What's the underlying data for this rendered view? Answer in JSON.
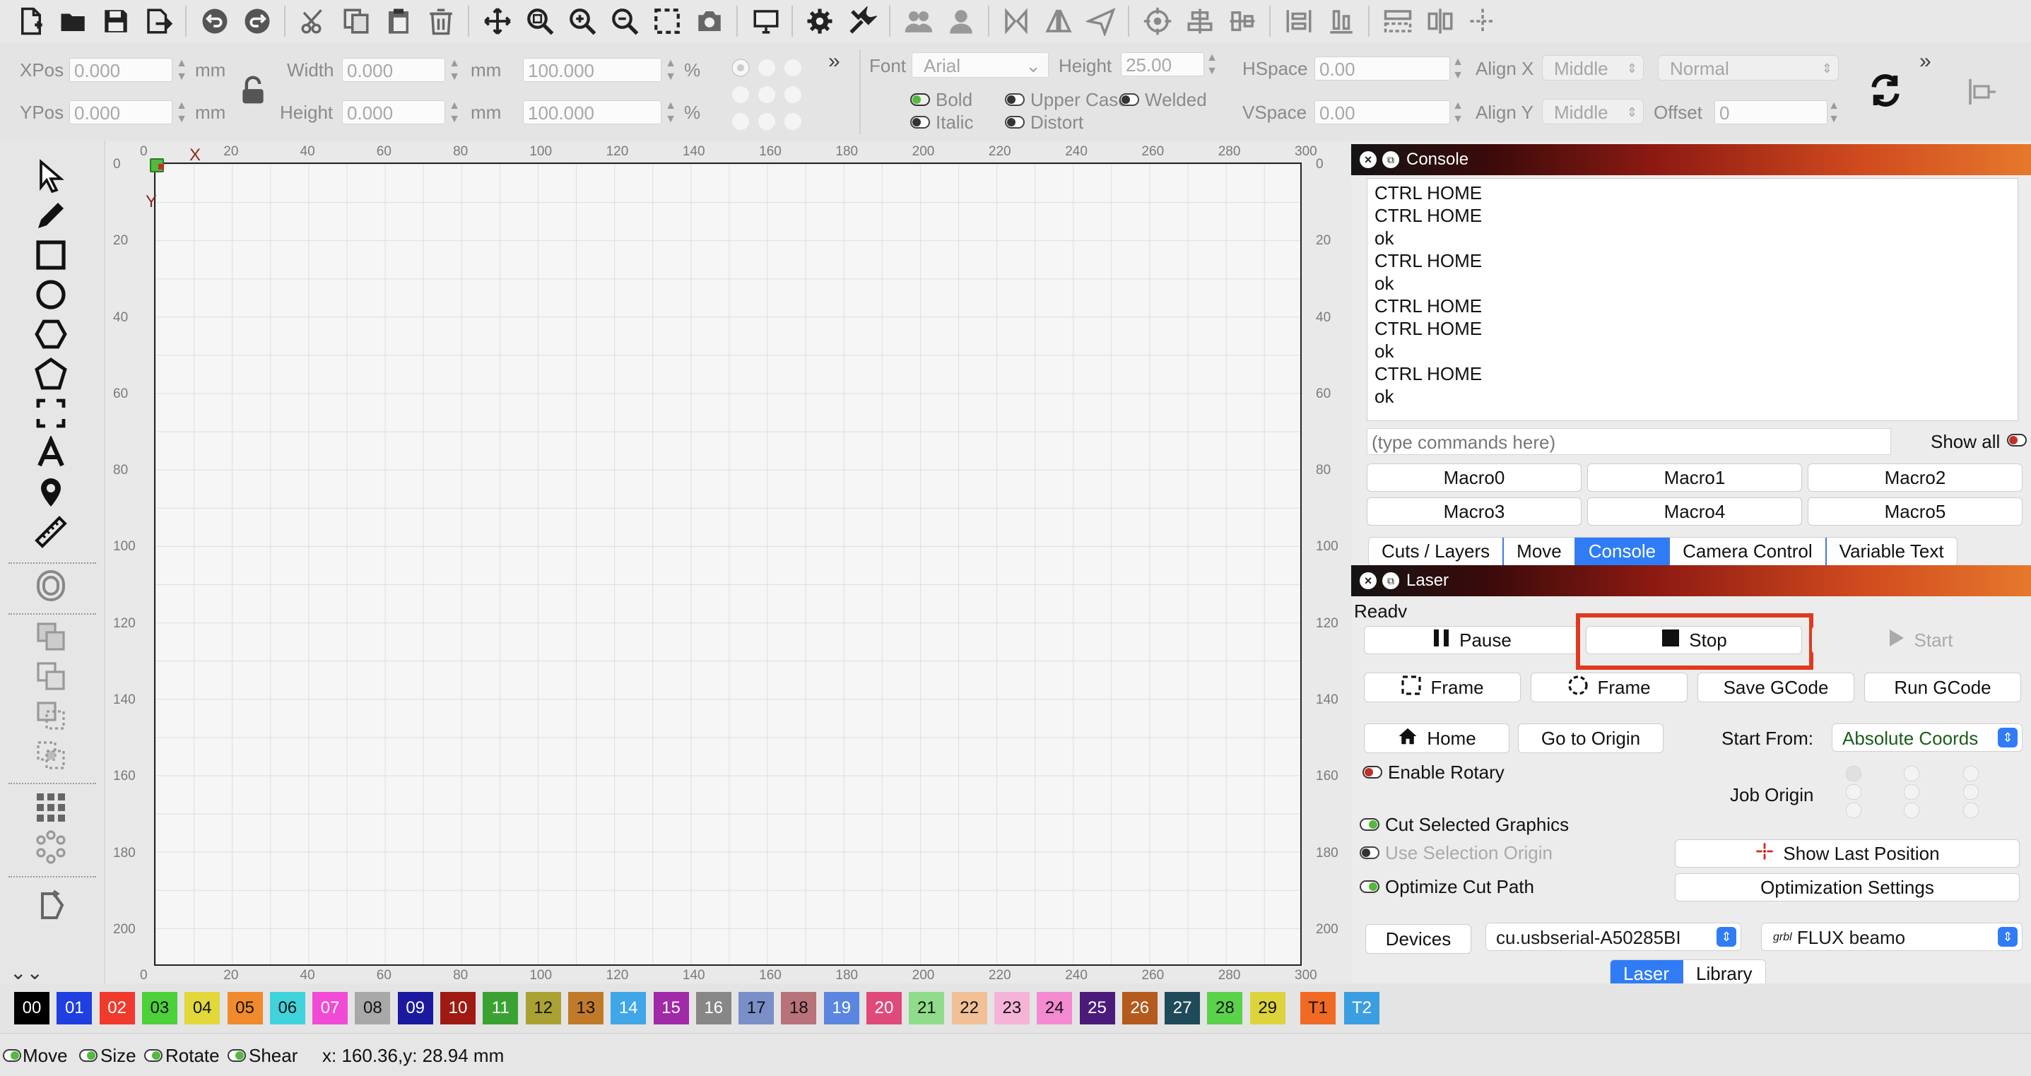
{
  "toolbar": {
    "icons": [
      "new-file-icon",
      "open-folder-icon",
      "save-icon",
      "export-icon",
      "undo-icon",
      "redo-icon",
      "cut-icon",
      "copy-icon",
      "paste-icon",
      "delete-icon",
      "move-icon",
      "zoom-fit-icon",
      "zoom-in-icon",
      "zoom-out-icon",
      "select-frame-icon",
      "camera-icon",
      "monitor-icon",
      "settings-icon",
      "tools-icon",
      "users-icon",
      "user-icon",
      "mirror-h-icon",
      "mirror-v-icon",
      "send-icon",
      "target-icon",
      "align-center-icon",
      "align-middle-icon",
      "distribute-h-icon",
      "distribute-v-icon",
      "dock-icon",
      "align-edge-icon",
      "crosshair-icon"
    ]
  },
  "properties": {
    "xpos_label": "XPos",
    "xpos_value": "0.000",
    "ypos_label": "YPos",
    "ypos_value": "0.000",
    "unit_mm": "mm",
    "width_label": "Width",
    "width_value": "0.000",
    "height_label": "Height",
    "height_value": "0.000",
    "scale_w": "100.000",
    "scale_h": "100.000",
    "percent": "%",
    "more": "»",
    "font_label": "Font",
    "font_value": "Arial",
    "text_height_label": "Height",
    "text_height_value": "25.00",
    "bold": "Bold",
    "italic": "Italic",
    "upper_case": "Upper Case",
    "welded": "Welded",
    "distort": "Distort",
    "hspace_label": "HSpace",
    "hspace_value": "0.00",
    "vspace_label": "VSpace",
    "vspace_value": "0.00",
    "alignx_label": "Align X",
    "alignx_value": "Middle",
    "aligny_label": "Align Y",
    "aligny_value": "Middle",
    "normal_value": "Normal",
    "offset_label": "Offset",
    "offset_value": "0"
  },
  "rulers": {
    "top": [
      "0",
      "20",
      "40",
      "60",
      "80",
      "100",
      "120",
      "140",
      "160",
      "180",
      "200",
      "220",
      "240",
      "260",
      "280",
      "300"
    ],
    "left": [
      "0",
      "20",
      "40",
      "60",
      "80",
      "100",
      "120",
      "140",
      "160",
      "180",
      "200"
    ],
    "axis_x": "X",
    "axis_y": "Y"
  },
  "console": {
    "title": "Console",
    "lines": [
      "CTRL HOME",
      "CTRL HOME",
      "ok",
      "CTRL HOME",
      "ok",
      "CTRL HOME",
      "CTRL HOME",
      "ok",
      "CTRL HOME",
      "ok"
    ],
    "command_placeholder": "(type commands here)",
    "show_all": "Show all",
    "macros": [
      "Macro0",
      "Macro1",
      "Macro2",
      "Macro3",
      "Macro4",
      "Macro5"
    ],
    "tabs": [
      "Cuts / Layers",
      "Move",
      "Console",
      "Camera Control",
      "Variable Text"
    ],
    "active_tab": "Console"
  },
  "laser": {
    "title": "Laser",
    "status": "Readv",
    "pause": "Pause",
    "stop": "Stop",
    "start": "Start",
    "frame1": "Frame",
    "frame2": "Frame",
    "save_gcode": "Save GCode",
    "run_gcode": "Run GCode",
    "home": "Home",
    "go_to_origin": "Go to Origin",
    "start_from_label": "Start From:",
    "start_from_value": "Absolute Coords",
    "enable_rotary": "Enable Rotary",
    "job_origin": "Job Origin",
    "cut_selected": "Cut Selected Graphics",
    "use_selection_origin": "Use Selection Origin",
    "optimize_cut_path": "Optimize Cut Path",
    "show_last_position": "Show Last Position",
    "optimization_settings": "Optimization Settings",
    "devices": "Devices",
    "port": "cu.usbserial-A50285BI",
    "device_prefix": "grbl",
    "device": "FLUX beamo",
    "bottom_tabs": [
      "Laser",
      "Library"
    ],
    "active_bottom_tab": "Laser"
  },
  "palette": [
    {
      "label": "00",
      "color": "#000000",
      "text": "#ffffff"
    },
    {
      "label": "01",
      "color": "#1f3fe0",
      "text": "#ffffff"
    },
    {
      "label": "02",
      "color": "#ef3a2c",
      "text": "#ffffff"
    },
    {
      "label": "03",
      "color": "#4cd13a",
      "text": "#111111"
    },
    {
      "label": "04",
      "color": "#e2d83a",
      "text": "#111111"
    },
    {
      "label": "05",
      "color": "#f08a2a",
      "text": "#111111"
    },
    {
      "label": "06",
      "color": "#3fd3dc",
      "text": "#111111"
    },
    {
      "label": "07",
      "color": "#f14ad6",
      "text": "#ffffff"
    },
    {
      "label": "08",
      "color": "#a8a8a8",
      "text": "#111111"
    },
    {
      "label": "09",
      "color": "#1a19a0",
      "text": "#ffffff"
    },
    {
      "label": "10",
      "color": "#a01a14",
      "text": "#ffffff"
    },
    {
      "label": "11",
      "color": "#3aa233",
      "text": "#ffffff"
    },
    {
      "label": "12",
      "color": "#a9a233",
      "text": "#111111"
    },
    {
      "label": "13",
      "color": "#c07a2a",
      "text": "#111111"
    },
    {
      "label": "14",
      "color": "#3fa6e8",
      "text": "#ffffff"
    },
    {
      "label": "15",
      "color": "#a02aa8",
      "text": "#ffffff"
    },
    {
      "label": "16",
      "color": "#878787",
      "text": "#ffffff"
    },
    {
      "label": "17",
      "color": "#7a8fc8",
      "text": "#111111"
    },
    {
      "label": "18",
      "color": "#b8727a",
      "text": "#111111"
    },
    {
      "label": "19",
      "color": "#5a86e0",
      "text": "#ffffff"
    },
    {
      "label": "20",
      "color": "#e04a7a",
      "text": "#ffffff"
    },
    {
      "label": "21",
      "color": "#8fdc8a",
      "text": "#111111"
    },
    {
      "label": "22",
      "color": "#f2c096",
      "text": "#111111"
    },
    {
      "label": "23",
      "color": "#f6b3d8",
      "text": "#111111"
    },
    {
      "label": "24",
      "color": "#f48ad2",
      "text": "#111111"
    },
    {
      "label": "25",
      "color": "#4b1a7a",
      "text": "#ffffff"
    },
    {
      "label": "26",
      "color": "#b35a1c",
      "text": "#ffffff"
    },
    {
      "label": "27",
      "color": "#1f4a5a",
      "text": "#ffffff"
    },
    {
      "label": "28",
      "color": "#5ad24a",
      "text": "#111111"
    },
    {
      "label": "29",
      "color": "#dcd43a",
      "text": "#111111"
    },
    {
      "label": "T1",
      "color": "#f06a24",
      "text": "#111111"
    },
    {
      "label": "T2",
      "color": "#3a9ee0",
      "text": "#ffffff"
    }
  ],
  "status": {
    "move": "Move",
    "size": "Size",
    "rotate": "Rotate",
    "shear": "Shear",
    "coords": "x: 160.36,y: 28.94 mm"
  }
}
